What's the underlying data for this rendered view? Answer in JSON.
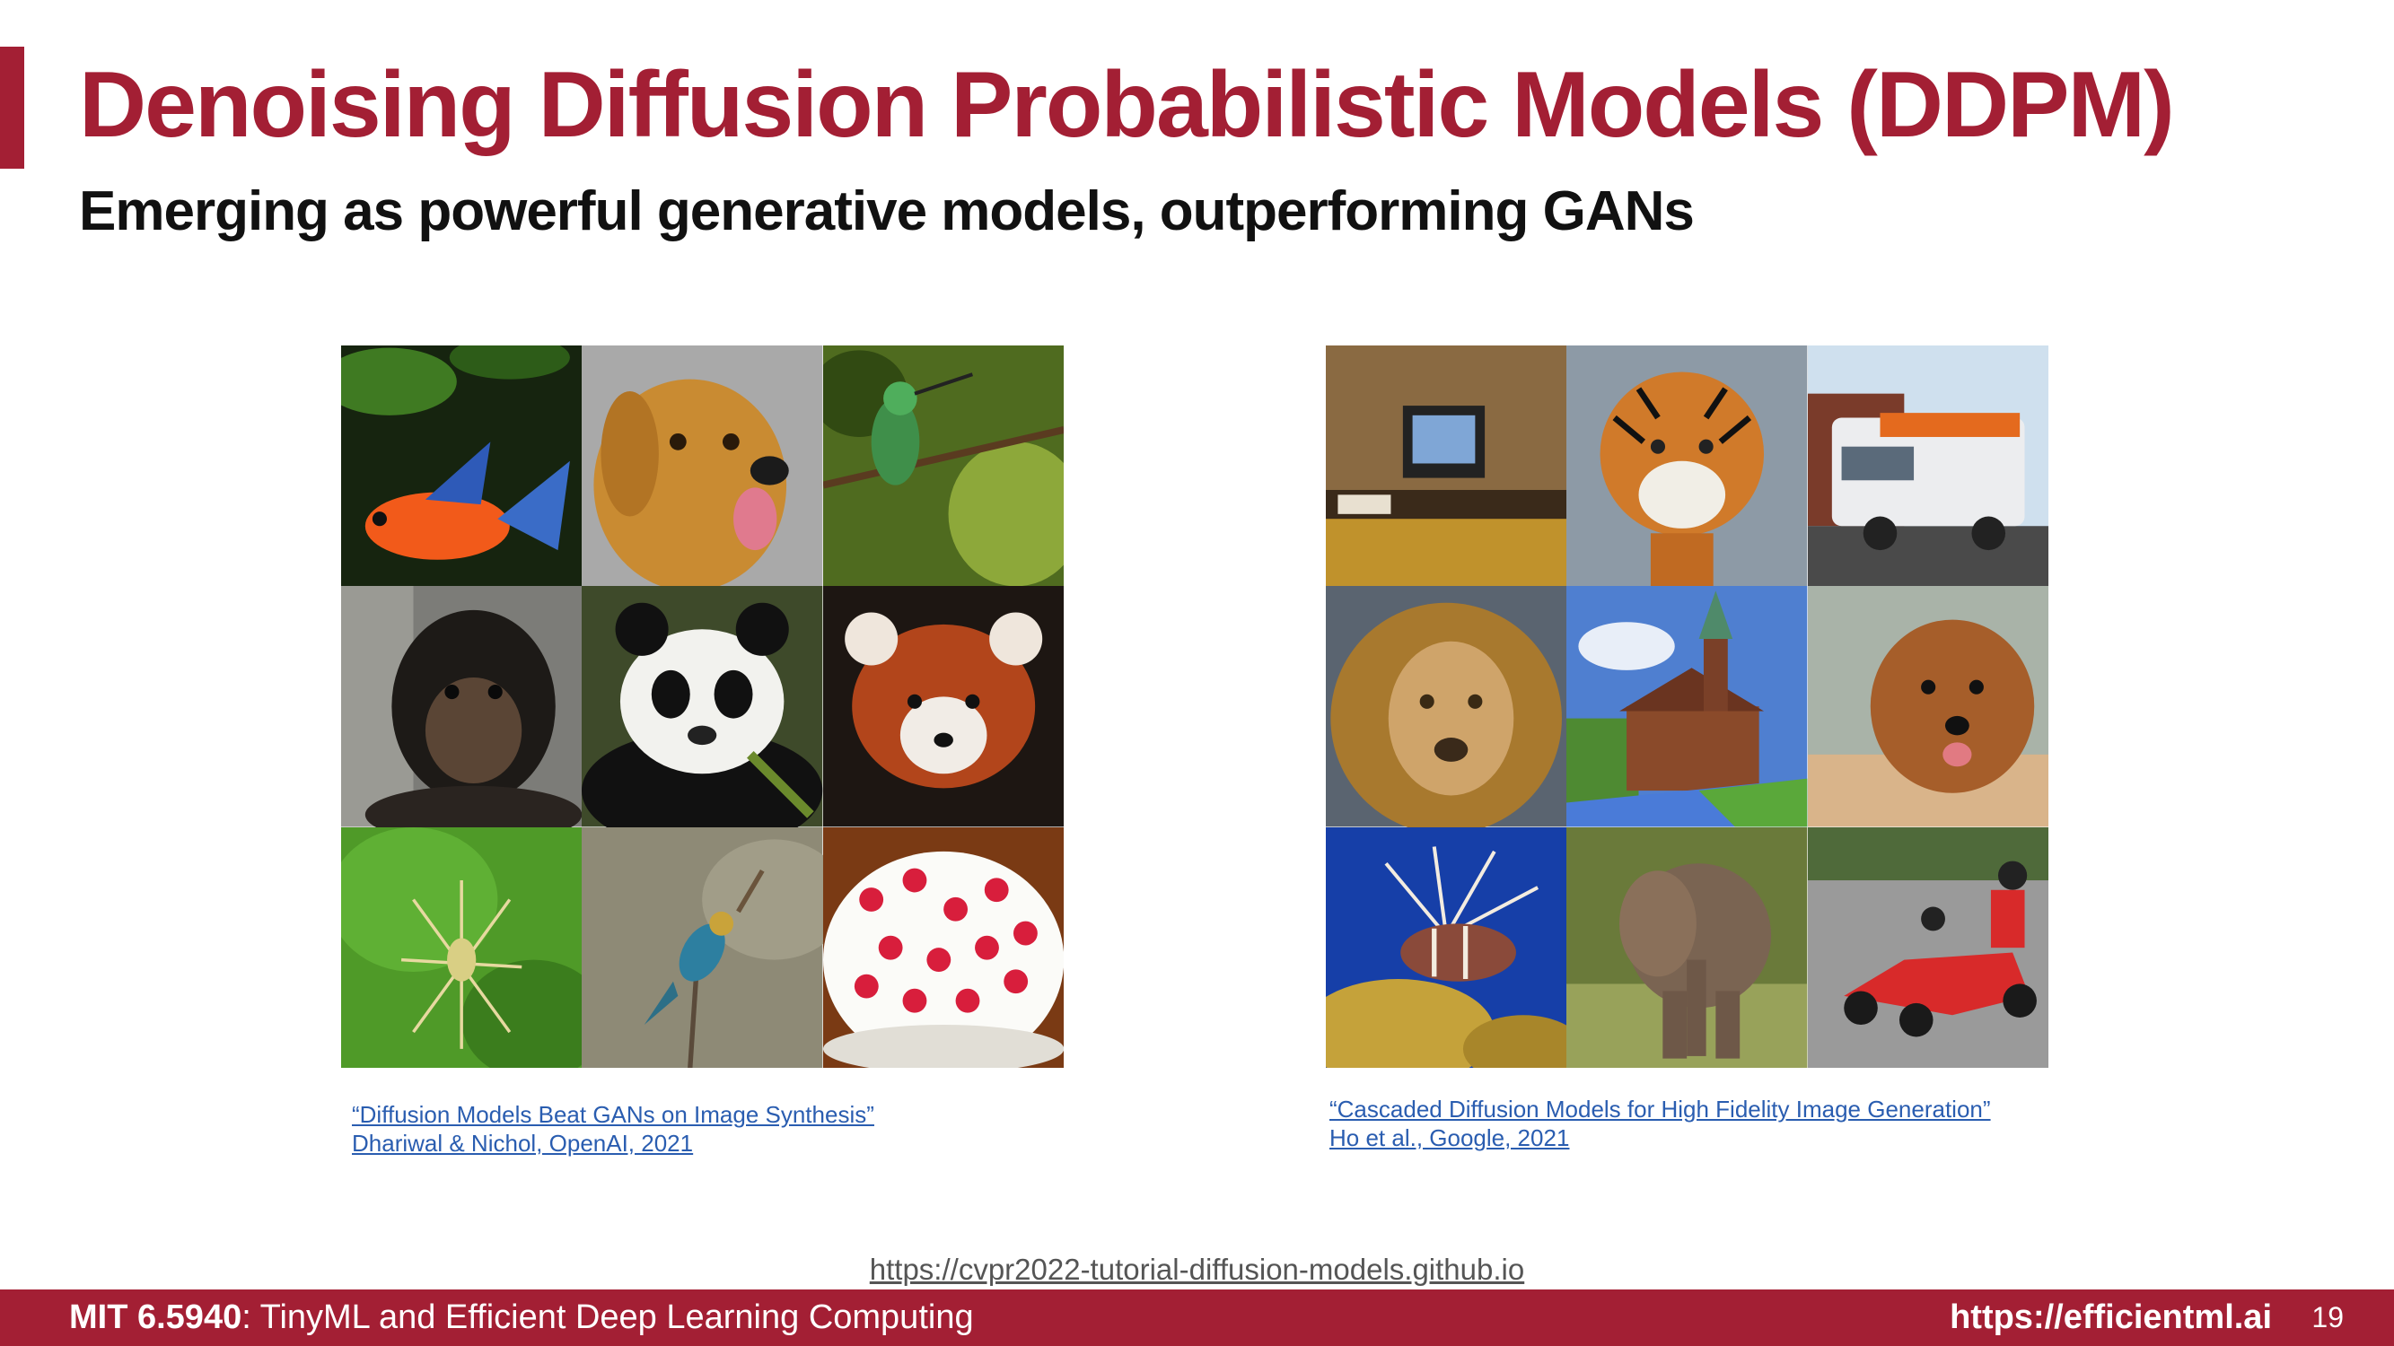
{
  "slide": {
    "title": "Denoising Diffusion Probabilistic Models (DDPM)",
    "subtitle": "Emerging as powerful generative models, outperforming GANs"
  },
  "left_figure": {
    "images": [
      {
        "icon": "goldfish-image"
      },
      {
        "icon": "golden-retriever-image"
      },
      {
        "icon": "hummingbird-image"
      },
      {
        "icon": "chimpanzee-image"
      },
      {
        "icon": "panda-image"
      },
      {
        "icon": "red-panda-image"
      },
      {
        "icon": "spider-image"
      },
      {
        "icon": "bee-eater-bird-image"
      },
      {
        "icon": "raspberry-dessert-image"
      }
    ],
    "caption_line1": "“Diffusion Models Beat GANs on Image Synthesis”",
    "caption_line2": "Dhariwal & Nichol, OpenAI, 2021"
  },
  "right_figure": {
    "images": [
      {
        "icon": "desk-computer-image"
      },
      {
        "icon": "tiger-image"
      },
      {
        "icon": "van-image"
      },
      {
        "icon": "lion-image"
      },
      {
        "icon": "church-image"
      },
      {
        "icon": "yorkshire-terrier-image"
      },
      {
        "icon": "lionfish-image"
      },
      {
        "icon": "elephant-image"
      },
      {
        "icon": "go-kart-image"
      }
    ],
    "caption_line1": "“Cascaded Diffusion Models for High Fidelity Image Generation”",
    "caption_line2": "Ho et al., Google, 2021"
  },
  "reference_url": "https://cvpr2022-tutorial-diffusion-models.github.io",
  "footer": {
    "course_code": "MIT 6.5940",
    "course_name": ": TinyML and Efficient Deep Learning Computing",
    "site": "https://efficientml.ai",
    "page_number": "19"
  },
  "colors": {
    "accent": "#a31f34",
    "link": "#2a5db0"
  }
}
